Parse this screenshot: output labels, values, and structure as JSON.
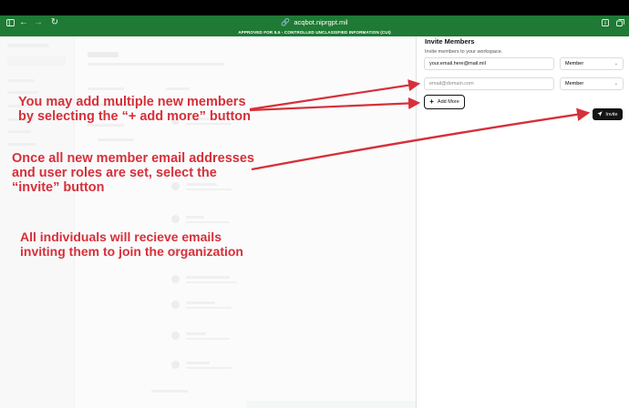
{
  "browser": {
    "url": "acqbot.niprgpt.mil",
    "banner": "APPROVED FOR IL5 - CONTROLLED UNCLASSIFIED INFORMATION (CUI)",
    "icons": [
      "sidebar-toggle-icon",
      "back-icon",
      "forward-icon",
      "reload-icon",
      "link-icon",
      "extensions-icon",
      "tabs-icon"
    ]
  },
  "panel": {
    "title": "Invite Members",
    "subtitle": "Invite members to your workspace.",
    "rows": [
      {
        "email_value": "your.email.here@mail.mil",
        "email_placeholder": "",
        "role": "Member"
      },
      {
        "email_value": "",
        "email_placeholder": "email@domain.com",
        "role": "Member"
      }
    ],
    "add_more_label": "Add More",
    "invite_label": "Invite"
  },
  "annotations": {
    "add_more": "You may add multiple new members by selecting the “+ add more” button",
    "invite": "Once all new member email addresses and user roles are set, select the “invite” button",
    "emails": "All individuals will recieve emails inviting them to join the organization"
  },
  "colors": {
    "accent_green": "#1e7a34",
    "annotation_red": "#d6303a",
    "invite_button": "#141414"
  }
}
